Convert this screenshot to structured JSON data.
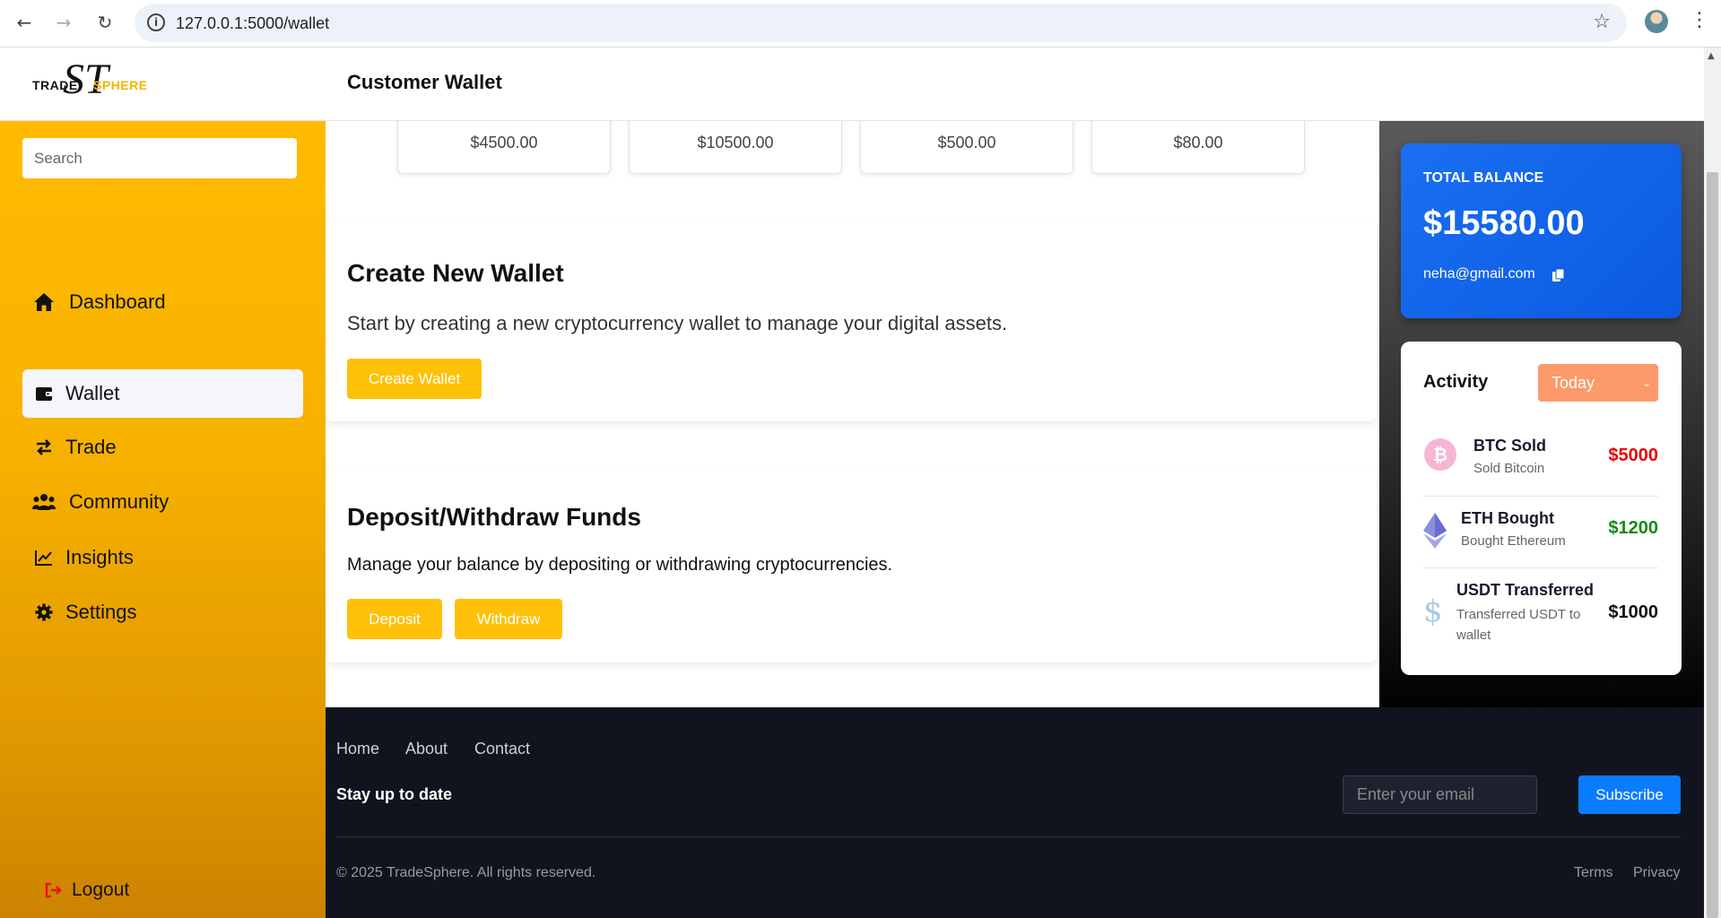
{
  "browser": {
    "url": "127.0.0.1:5000/wallet",
    "info_glyph": "i"
  },
  "header": {
    "logo_trade": "TRADE",
    "logo_sphere": "SPHERE",
    "logo_monogram": "ST",
    "title": "Customer Wallet"
  },
  "sidebar": {
    "search_placeholder": "Search",
    "items": [
      {
        "label": "Dashboard",
        "icon": "home-icon",
        "active": false
      },
      {
        "label": "Wallet",
        "icon": "wallet-icon",
        "active": true
      },
      {
        "label": "Trade",
        "icon": "exchange-icon",
        "active": false
      },
      {
        "label": "Community",
        "icon": "users-icon",
        "active": false
      },
      {
        "label": "Insights",
        "icon": "chart-line-icon",
        "active": false
      },
      {
        "label": "Settings",
        "icon": "gear-icon",
        "active": false
      }
    ],
    "logout_label": "Logout"
  },
  "stats": [
    "$4500.00",
    "$10500.00",
    "$500.00",
    "$80.00"
  ],
  "create_wallet": {
    "title": "Create New Wallet",
    "description": "Start by creating a new cryptocurrency wallet to manage your digital assets.",
    "button": "Create Wallet"
  },
  "funds": {
    "title": "Deposit/Withdraw Funds",
    "description": "Manage your balance by depositing or withdrawing cryptocurrencies.",
    "deposit_button": "Deposit",
    "withdraw_button": "Withdraw"
  },
  "balance": {
    "label": "TOTAL BALANCE",
    "amount": "$15580.00",
    "email": "neha@gmail.com"
  },
  "activity": {
    "title": "Activity",
    "filter": "Today",
    "items": [
      {
        "name": "BTC Sold",
        "desc": "Sold Bitcoin",
        "amount": "$5000",
        "icon": "bitcoin-icon",
        "amount_color": "#e8000b"
      },
      {
        "name": "ETH Bought",
        "desc": "Bought Ethereum",
        "amount": "$1200",
        "icon": "ethereum-icon",
        "amount_color": "#178a17"
      },
      {
        "name": "USDT Transferred",
        "desc": "Transferred USDT to wallet",
        "amount": "$1000",
        "icon": "dollar-icon",
        "amount_color": "#111111"
      }
    ]
  },
  "footer": {
    "links": [
      "Home",
      "About",
      "Contact"
    ],
    "heading": "Stay up to date",
    "email_placeholder": "Enter your email",
    "subscribe": "Subscribe",
    "copyright": "© 2025 TradeSphere. All rights reserved.",
    "terms": "Terms",
    "privacy": "Privacy"
  },
  "colors": {
    "accent_yellow": "#ffc107",
    "balance_blue": "#0a5ae0",
    "subscribe_blue": "#0a7cff",
    "filter_orange": "#fd9a6b",
    "sell_red": "#e8000b",
    "buy_green": "#178a17"
  }
}
